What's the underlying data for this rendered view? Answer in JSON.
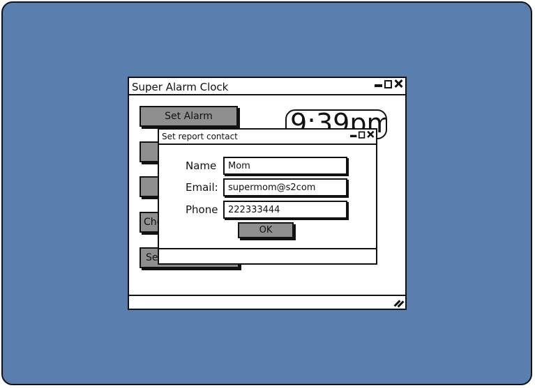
{
  "main_window": {
    "title": "Super Alarm Clock",
    "time": "9:39pm",
    "buttons": [
      {
        "label": "Set Alarm"
      },
      {
        "label": ""
      },
      {
        "label": ""
      },
      {
        "label": "Che"
      },
      {
        "label": "Se"
      }
    ]
  },
  "dialog": {
    "title": "Set report contact",
    "name_label": "Name",
    "name_value": "Mom",
    "email_label": "Email:",
    "email_value": "supermom@s2com",
    "phone_label": "Phone",
    "phone_value": "222333444",
    "ok_label": "OK"
  },
  "icons": [
    "minimize-icon",
    "maximize-icon",
    "close-icon",
    "resize-grip-icon"
  ],
  "colors": {
    "background": "#5a7fae",
    "button_fill": "#8f8f8f",
    "outline": "#111111"
  }
}
